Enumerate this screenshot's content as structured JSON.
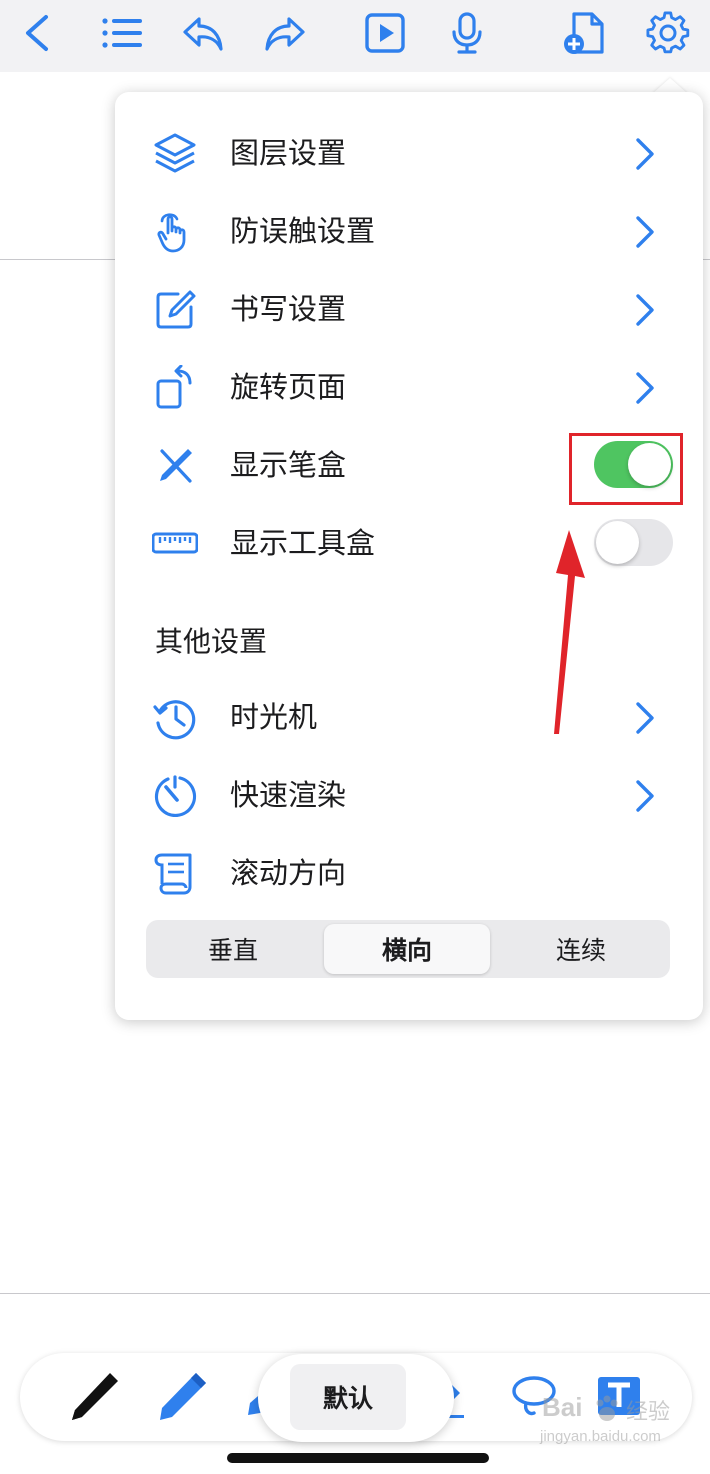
{
  "colors": {
    "accent": "#2f80ed",
    "toggle_on": "#4fc561",
    "toggle_off": "#e6e6e9",
    "annotation_red": "#e0242a"
  },
  "toolbar": {
    "icons": [
      "back-chevron-icon",
      "list-icon",
      "undo-icon",
      "redo-icon",
      "play-icon",
      "microphone-icon",
      "add-page-icon",
      "gear-icon"
    ]
  },
  "menu": {
    "items": [
      {
        "label": "图层设置",
        "icon": "layers-icon",
        "control": "chevron"
      },
      {
        "label": "防误触设置",
        "icon": "hand-touch-icon",
        "control": "chevron"
      },
      {
        "label": "书写设置",
        "icon": "edit-square-icon",
        "control": "chevron"
      },
      {
        "label": "旋转页面",
        "icon": "rotate-page-icon",
        "control": "chevron"
      },
      {
        "label": "显示笔盒",
        "icon": "pen-tools-icon",
        "control": "toggle",
        "on": true
      },
      {
        "label": "显示工具盒",
        "icon": "ruler-icon",
        "control": "toggle",
        "on": false
      }
    ],
    "section_title": "其他设置",
    "other_items": [
      {
        "label": "时光机",
        "icon": "history-icon",
        "control": "chevron"
      },
      {
        "label": "快速渲染",
        "icon": "timer-icon",
        "control": "chevron"
      },
      {
        "label": "滚动方向",
        "icon": "scroll-icon",
        "control": "none"
      }
    ],
    "scroll_direction": {
      "options": [
        "垂直",
        "横向",
        "连续"
      ],
      "selected": "横向"
    }
  },
  "penbar": {
    "tools": [
      "pen-icon",
      "pencil-icon",
      "highlighter-icon",
      "marker-icon",
      "lasso-icon",
      "text-tool-icon"
    ],
    "preset_label": "默认"
  },
  "watermark": {
    "brand": "Bai",
    "brand_suffix": "经验",
    "url": "jingyan.baidu.com"
  }
}
